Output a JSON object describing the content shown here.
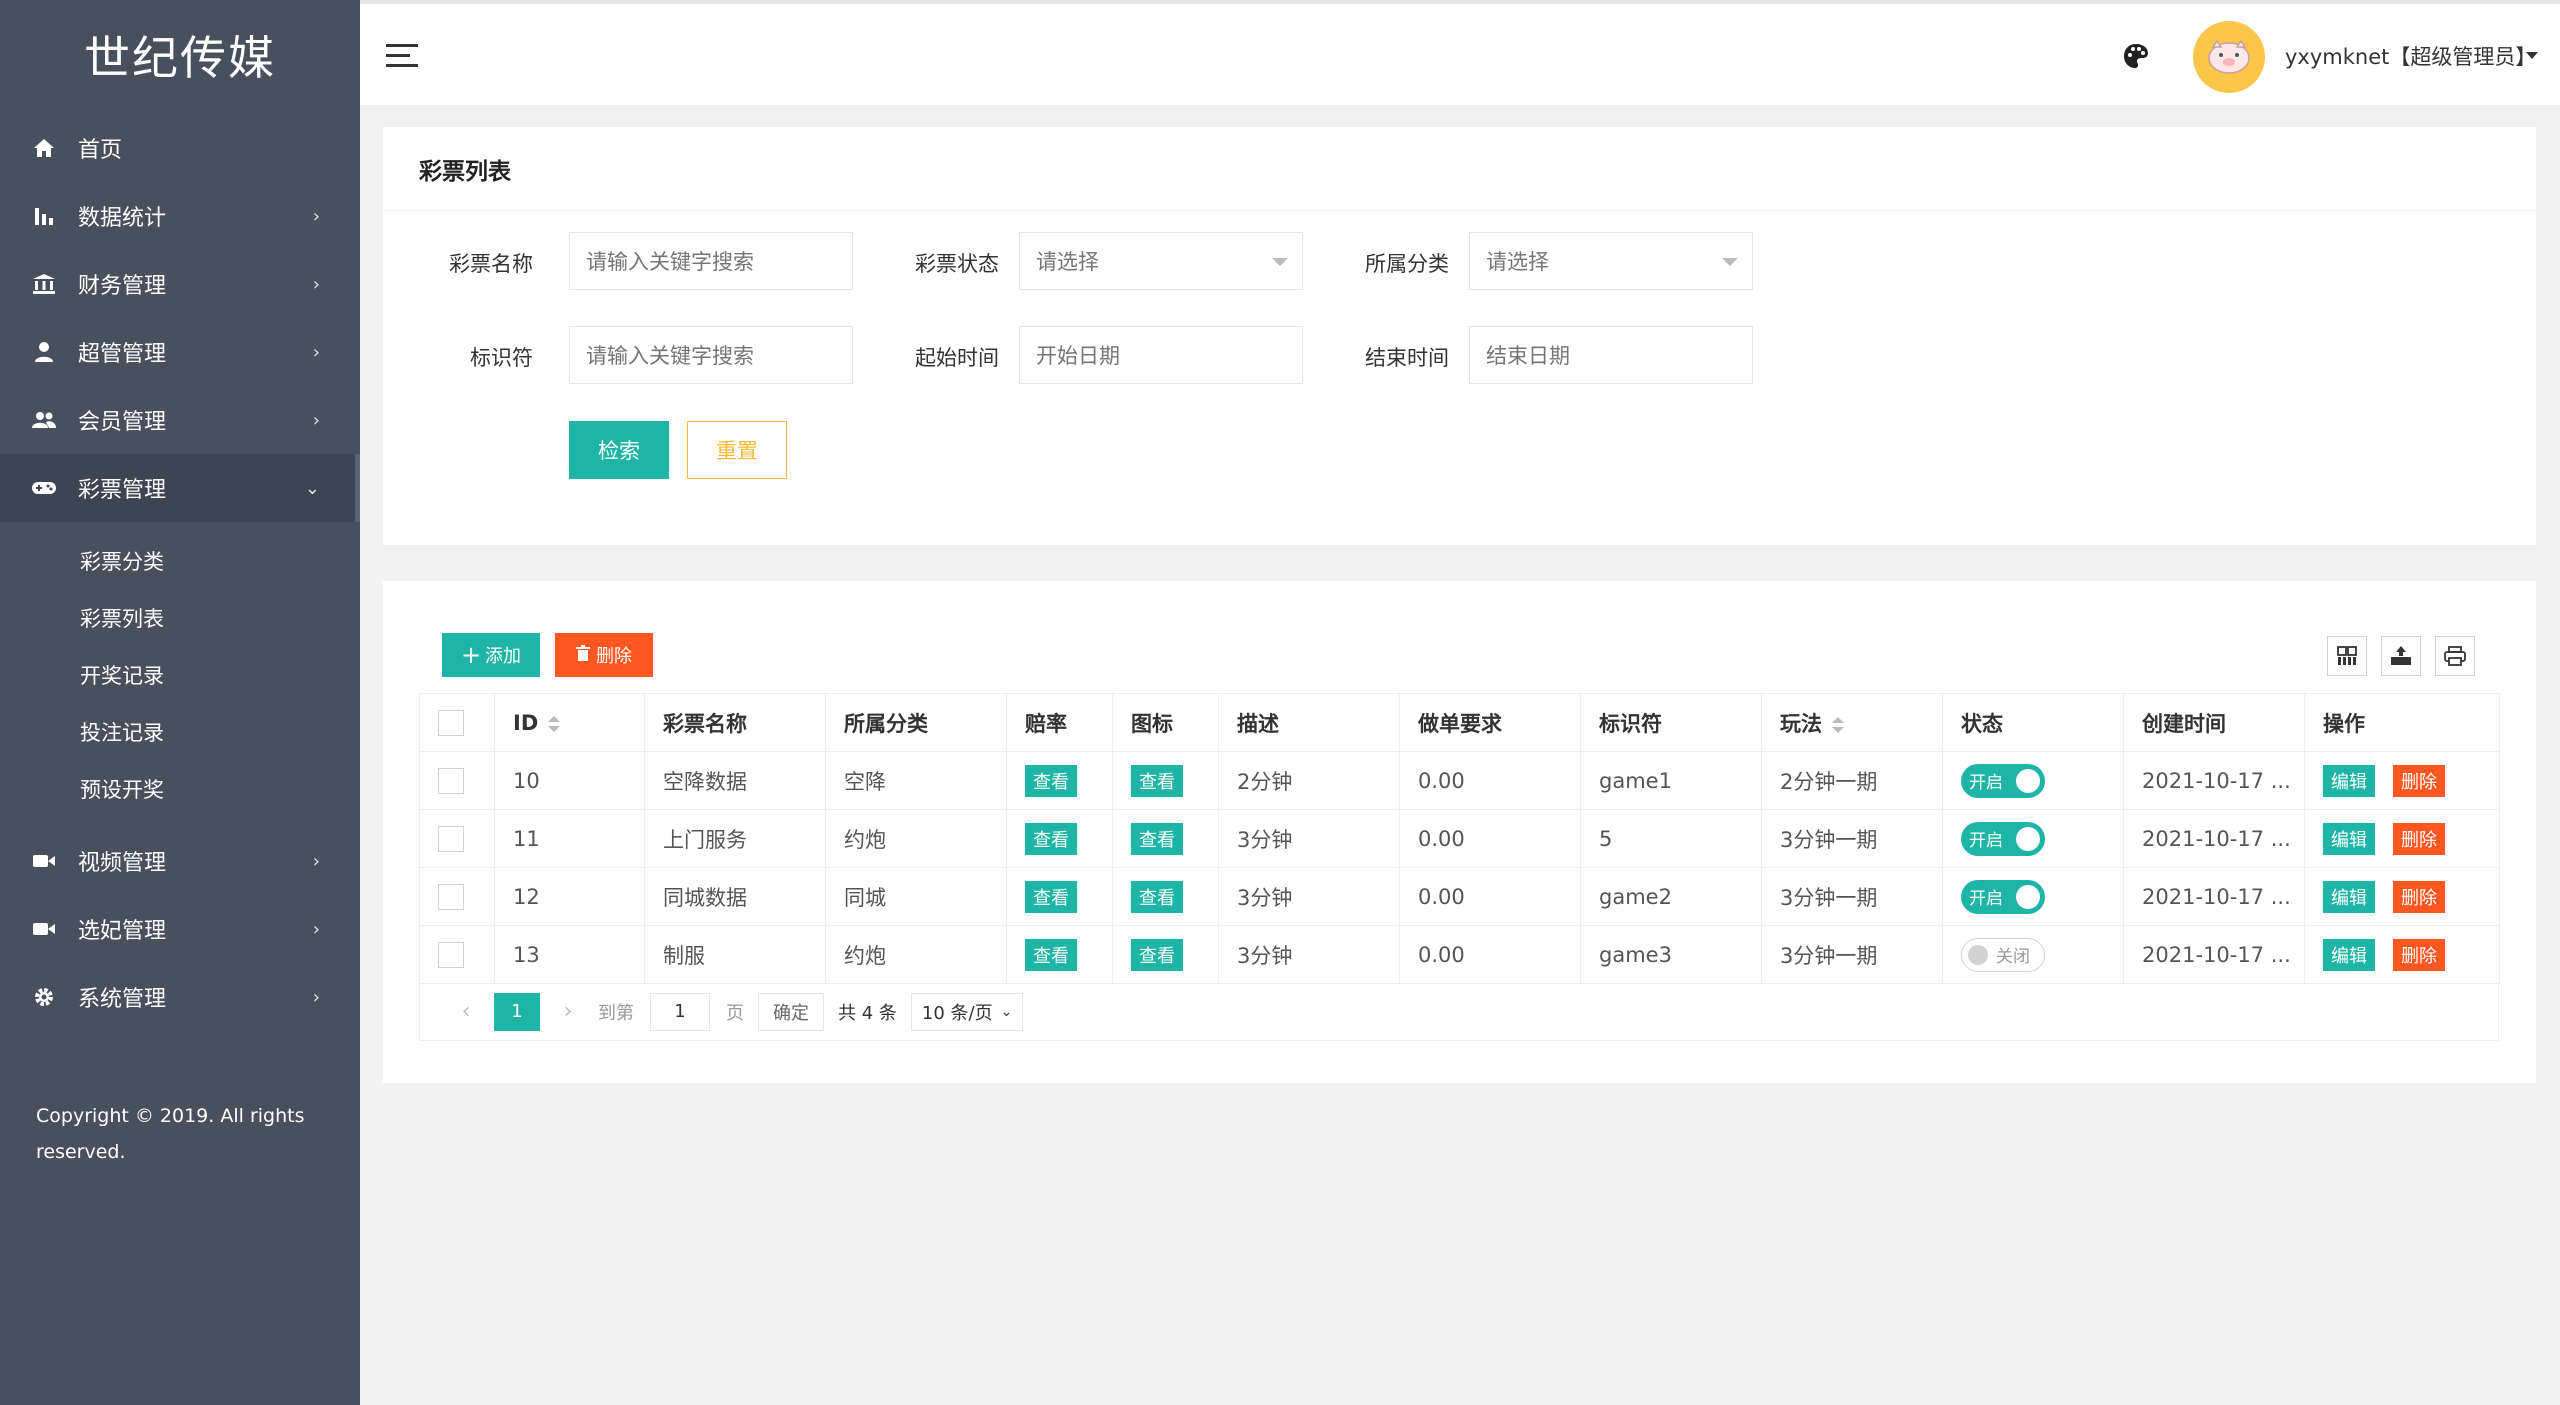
{
  "sidebar": {
    "logo": "世纪传媒",
    "items": [
      {
        "label": "首页",
        "chev": ""
      },
      {
        "label": "数据统计",
        "chev": "›"
      },
      {
        "label": "财务管理",
        "chev": "›"
      },
      {
        "label": "超管管理",
        "chev": "›"
      },
      {
        "label": "会员管理",
        "chev": "›"
      },
      {
        "label": "彩票管理",
        "chev": "⌄"
      }
    ],
    "sub_items": [
      "彩票分类",
      "彩票列表",
      "开奖记录",
      "投注记录",
      "预设开奖"
    ],
    "items_after": [
      {
        "label": "视频管理",
        "chev": "›"
      },
      {
        "label": "选妃管理",
        "chev": "›"
      },
      {
        "label": "系统管理",
        "chev": "›"
      }
    ],
    "copyright": "Copyright © 2019. All rights reserved."
  },
  "header": {
    "username": "yxymknet【超级管理员】"
  },
  "filter": {
    "title": "彩票列表",
    "name_label": "彩票名称",
    "name_placeholder": "请输入关键字搜索",
    "status_label": "彩票状态",
    "status_value": "请选择",
    "category_label": "所属分类",
    "category_value": "请选择",
    "key_label": "标识符",
    "key_placeholder": "请输入关键字搜索",
    "start_label": "起始时间",
    "start_placeholder": "开始日期",
    "end_label": "结束时间",
    "end_placeholder": "结束日期",
    "search_btn": "检索",
    "reset_btn": "重置"
  },
  "table": {
    "add_btn": "添加",
    "delete_btn": "删除",
    "columns": [
      "ID",
      "彩票名称",
      "所属分类",
      "赔率",
      "图标",
      "描述",
      "做单要求",
      "标识符",
      "玩法",
      "状态",
      "创建时间",
      "操作"
    ],
    "view_label": "查看",
    "edit_label": "编辑",
    "remove_label": "删除",
    "on_label": "开启",
    "off_label": "关闭",
    "rows": [
      {
        "id": "10",
        "name": "空降数据",
        "category": "空降",
        "desc": "2分钟",
        "req": "0.00",
        "key": "game1",
        "play": "2分钟一期",
        "on": true,
        "created": "2021-10-17 ..."
      },
      {
        "id": "11",
        "name": "上门服务",
        "category": "约炮",
        "desc": "3分钟",
        "req": "0.00",
        "key": "5",
        "play": "3分钟一期",
        "on": true,
        "created": "2021-10-17 ..."
      },
      {
        "id": "12",
        "name": "同城数据",
        "category": "同城",
        "desc": "3分钟",
        "req": "0.00",
        "key": "game2",
        "play": "3分钟一期",
        "on": true,
        "created": "2021-10-17 ..."
      },
      {
        "id": "13",
        "name": "制服",
        "category": "约炮",
        "desc": "3分钟",
        "req": "0.00",
        "key": "game3",
        "play": "3分钟一期",
        "on": false,
        "created": "2021-10-17 ..."
      }
    ]
  },
  "pager": {
    "current": "1",
    "goto_label": "到第",
    "goto_value": "1",
    "page_unit": "页",
    "confirm": "确定",
    "total": "共 4 条",
    "per_page": "10 条/页"
  }
}
